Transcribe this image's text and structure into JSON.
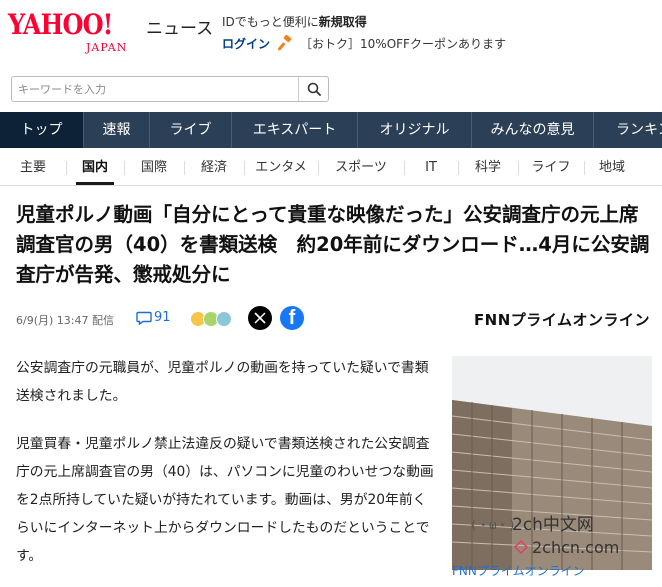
{
  "header": {
    "logo_text": "YAHOO!",
    "logo_sub": "JAPAN",
    "service_name": "ニュース",
    "promo_prefix": "IDでもっと便利に",
    "promo_link": "新規取得",
    "login_label": "ログイン",
    "coupon_text": "［おトク］10%OFFクーポンあります"
  },
  "search": {
    "placeholder": "キーワードを入力"
  },
  "main_nav": [
    {
      "label": "トップ",
      "active": true
    },
    {
      "label": "速報",
      "active": false
    },
    {
      "label": "ライブ",
      "active": false
    },
    {
      "label": "エキスパート",
      "active": false
    },
    {
      "label": "オリジナル",
      "active": false
    },
    {
      "label": "みんなの意見",
      "active": false
    },
    {
      "label": "ランキング",
      "active": false
    }
  ],
  "sub_nav": [
    {
      "label": "主要",
      "active": false
    },
    {
      "label": "国内",
      "active": true
    },
    {
      "label": "国際",
      "active": false
    },
    {
      "label": "経済",
      "active": false
    },
    {
      "label": "エンタメ",
      "active": false
    },
    {
      "label": "スポーツ",
      "active": false
    },
    {
      "label": "IT",
      "active": false
    },
    {
      "label": "科学",
      "active": false
    },
    {
      "label": "ライフ",
      "active": false
    },
    {
      "label": "地域",
      "active": false
    }
  ],
  "article": {
    "title": "児童ポルノ動画「自分にとって貴重な映像だった」公安調査庁の元上席調査官の男（40）を書類送検　約20年前にダウンロード…4月に公安調査庁が告発、懲戒処分に",
    "date": "6/9(月) 13:47 配信",
    "comment_count": "91",
    "source": "FNNプライムオンライン",
    "paragraphs": [
      "公安調査庁の元職員が、児童ポルノの動画を持っていた疑いで書類送検されました。",
      "児童買春・児童ポルノ禁止法違反の疑いで書類送検された公安調査庁の元上席調査官の男（40）は、パソコンに児童のわいせつな動画を2点所持していた疑いが持たれています。動画は、男が20年前くらいにインターネット上からダウンロードしたものだということです。"
    ],
    "photo_caption": "FNNプライムオンライン"
  },
  "watermark": {
    "face": "(・ω・)",
    "title": "2ch中文网",
    "url": "2chcn.com"
  },
  "colors": {
    "brand_red": "#ff0033",
    "nav_bg": "#2b3f56",
    "link_blue": "#1f6fd1"
  }
}
